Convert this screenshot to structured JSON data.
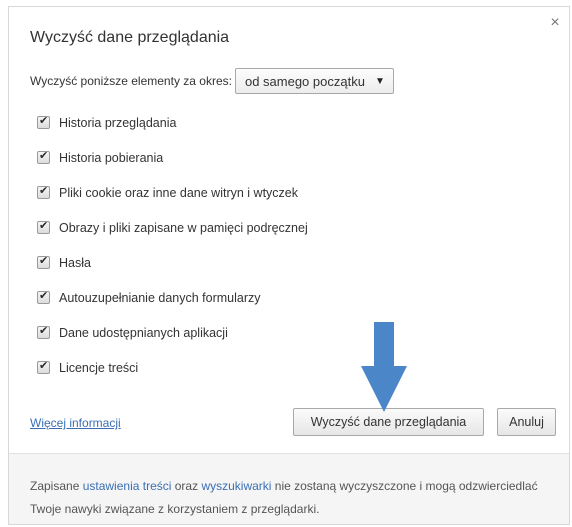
{
  "dialog": {
    "title": "Wyczyść dane przeglądania",
    "close_label": "×",
    "period_label": "Wyczyść poniższe elementy za okres:",
    "period_value": "od samego początku",
    "options": [
      {
        "label": "Historia przeglądania",
        "checked": true
      },
      {
        "label": "Historia pobierania",
        "checked": true
      },
      {
        "label": "Pliki cookie oraz inne dane witryn i wtyczek",
        "checked": true
      },
      {
        "label": "Obrazy i pliki zapisane w pamięci podręcznej",
        "checked": true
      },
      {
        "label": "Hasła",
        "checked": true
      },
      {
        "label": "Autouzupełnianie danych formularzy",
        "checked": true
      },
      {
        "label": "Dane udostępnianych aplikacji",
        "checked": true
      },
      {
        "label": "Licencje treści",
        "checked": true
      }
    ],
    "more_info_link": "Więcej informacji",
    "clear_button": "Wyczyść dane przeglądania",
    "cancel_button": "Anuluj"
  },
  "footer": {
    "text_1": "Zapisane ",
    "link_1": "ustawienia treści",
    "text_2": " oraz ",
    "link_2": "wyszukiwarki",
    "text_3": " nie zostaną wyczyszczone i mogą odzwierciedlać Twoje nawyki związane z korzystaniem z przeglądarki."
  },
  "colors": {
    "link": "#3a6fb5",
    "arrow": "#4a86c8"
  }
}
